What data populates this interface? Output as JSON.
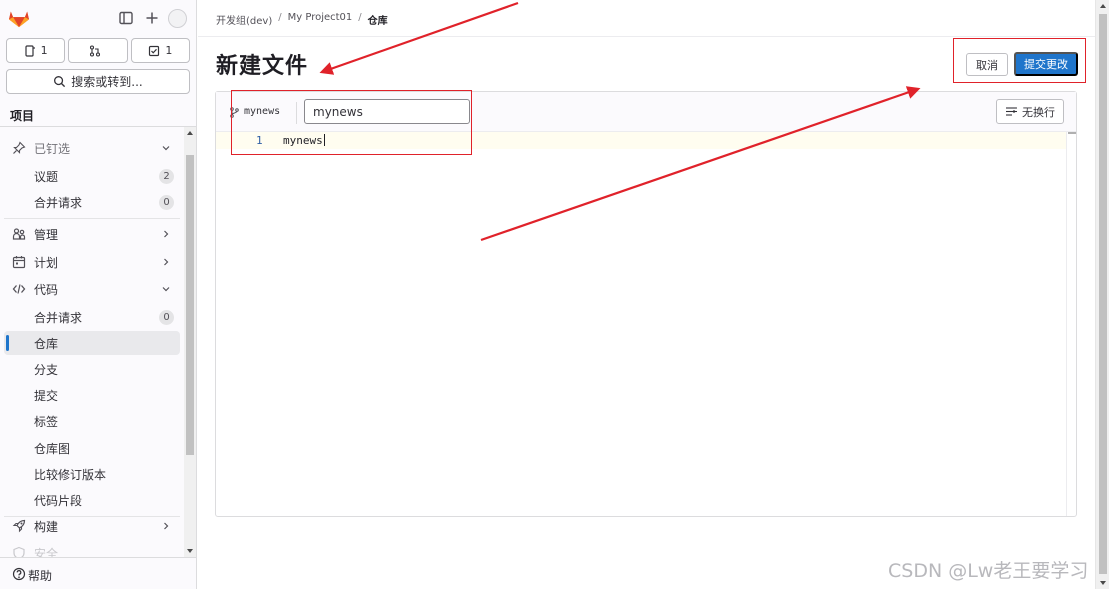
{
  "sidebar": {
    "counters": [
      {
        "icon": "issue-icon",
        "count": "1"
      },
      {
        "icon": "merge-request-icon",
        "count": ""
      },
      {
        "icon": "todo-icon",
        "count": "1"
      }
    ],
    "search_label": "搜索或转到...",
    "section_label": "项目",
    "pinned": {
      "label": "已钉选",
      "items": [
        {
          "label": "议题",
          "badge": "2"
        },
        {
          "label": "合并请求",
          "badge": "0"
        }
      ]
    },
    "manage": "管理",
    "plan": "计划",
    "code": {
      "label": "代码",
      "items": [
        {
          "label": "合并请求",
          "badge": "0"
        },
        {
          "label": "仓库"
        },
        {
          "label": "分支"
        },
        {
          "label": "提交"
        },
        {
          "label": "标签"
        },
        {
          "label": "仓库图"
        },
        {
          "label": "比较修订版本"
        },
        {
          "label": "代码片段"
        }
      ]
    },
    "build": "构建",
    "secure": "安全",
    "help": "帮助"
  },
  "breadcrumb": [
    "开发组(dev)",
    "My Project01",
    "仓库"
  ],
  "page_title": "新建文件",
  "actions": {
    "cancel": "取消",
    "commit": "提交更改"
  },
  "editor": {
    "branch": "mynews",
    "filename_value": "mynews",
    "wrap_label": "无换行",
    "lines": [
      {
        "number": "1",
        "text": "mynews"
      }
    ]
  },
  "watermark": "CSDN @Lw老王要学习",
  "colors": {
    "accent": "#1f75cb",
    "annotation": "#e0222a"
  }
}
